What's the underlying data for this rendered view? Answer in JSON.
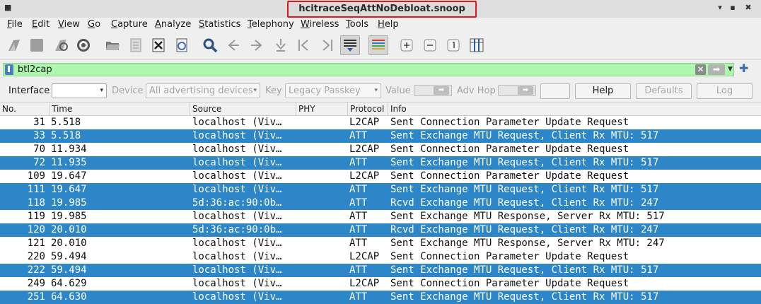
{
  "window": {
    "title": "hcitraceSeqAttNoDebloat.snoop",
    "app_icon": "■",
    "min_glyph": "▾",
    "max_glyph": "▪",
    "close_glyph": "✖"
  },
  "menu": [
    "File",
    "Edit",
    "View",
    "Go",
    "Capture",
    "Analyze",
    "Statistics",
    "Telephony",
    "Wireless",
    "Tools",
    "Help"
  ],
  "toolbar": {
    "icons": [
      "shark-fin-start-icon",
      "stop-capture-icon",
      "restart-capture-icon",
      "capture-options-icon",
      "open-file-icon",
      "save-file-icon",
      "close-file-icon",
      "reload-file-icon",
      "find-packet-icon",
      "go-back-icon",
      "go-forward-icon",
      "go-to-packet-icon",
      "first-packet-icon",
      "last-packet-icon",
      "auto-scroll-icon",
      "colorize-icon",
      "zoom-in-icon",
      "zoom-out-icon",
      "normal-size-icon",
      "resize-columns-icon"
    ]
  },
  "filter": {
    "value": "btl2cap",
    "clear_glyph": "✕",
    "apply_glyph": "➡",
    "dropdown_glyph": "▼",
    "add_glyph": "✚"
  },
  "interface_bar": {
    "interface_label": "Interface",
    "interface_value": "",
    "device_label": "Device",
    "device_value": "All advertising devices",
    "key_label": "Key",
    "key_value": "Legacy Passkey",
    "value_label": "Value",
    "adv_hop_label": "Adv Hop",
    "help_label": "Help",
    "defaults_label": "Defaults",
    "log_label": "Log",
    "arrow_glyph": "▾",
    "slider_glyph": "➡"
  },
  "packet_list": {
    "columns": [
      "No.",
      "Time",
      "Source",
      "PHY",
      "Protocol",
      "Info"
    ],
    "rows": [
      {
        "no": "31",
        "time": "5.518",
        "source": "localhost (Viv…",
        "phy": "",
        "protocol": "L2CAP",
        "info": "Sent Connection Parameter Update Request",
        "selected": false
      },
      {
        "no": "33",
        "time": "5.518",
        "source": "localhost (Viv…",
        "phy": "",
        "protocol": "ATT",
        "info": "Sent Exchange MTU Request, Client Rx MTU: 517",
        "selected": true
      },
      {
        "no": "70",
        "time": "11.934",
        "source": "localhost (Viv…",
        "phy": "",
        "protocol": "L2CAP",
        "info": "Sent Connection Parameter Update Request",
        "selected": false
      },
      {
        "no": "72",
        "time": "11.935",
        "source": "localhost (Viv…",
        "phy": "",
        "protocol": "ATT",
        "info": "Sent Exchange MTU Request, Client Rx MTU: 517",
        "selected": true
      },
      {
        "no": "109",
        "time": "19.647",
        "source": "localhost (Viv…",
        "phy": "",
        "protocol": "L2CAP",
        "info": "Sent Connection Parameter Update Request",
        "selected": false
      },
      {
        "no": "111",
        "time": "19.647",
        "source": "localhost (Viv…",
        "phy": "",
        "protocol": "ATT",
        "info": "Sent Exchange MTU Request, Client Rx MTU: 517",
        "selected": true
      },
      {
        "no": "118",
        "time": "19.985",
        "source": "5d:36:ac:90:0b…",
        "phy": "",
        "protocol": "ATT",
        "info": "Rcvd Exchange MTU Request, Client Rx MTU: 247",
        "selected": true
      },
      {
        "no": "119",
        "time": "19.985",
        "source": "localhost (Viv…",
        "phy": "",
        "protocol": "ATT",
        "info": "Sent Exchange MTU Response, Server Rx MTU: 517",
        "selected": false
      },
      {
        "no": "120",
        "time": "20.010",
        "source": "5d:36:ac:90:0b…",
        "phy": "",
        "protocol": "ATT",
        "info": "Rcvd Exchange MTU Request, Client Rx MTU: 247",
        "selected": true
      },
      {
        "no": "121",
        "time": "20.010",
        "source": "localhost (Viv…",
        "phy": "",
        "protocol": "ATT",
        "info": "Sent Exchange MTU Response, Server Rx MTU: 247",
        "selected": false
      },
      {
        "no": "220",
        "time": "59.494",
        "source": "localhost (Viv…",
        "phy": "",
        "protocol": "L2CAP",
        "info": "Sent Connection Parameter Update Request",
        "selected": false
      },
      {
        "no": "222",
        "time": "59.494",
        "source": "localhost (Viv…",
        "phy": "",
        "protocol": "ATT",
        "info": "Sent Exchange MTU Request, Client Rx MTU: 517",
        "selected": true
      },
      {
        "no": "249",
        "time": "64.629",
        "source": "localhost (Viv…",
        "phy": "",
        "protocol": "L2CAP",
        "info": "Sent Connection Parameter Update Request",
        "selected": false
      },
      {
        "no": "251",
        "time": "64.630",
        "source": "localhost (Viv…",
        "phy": "",
        "protocol": "ATT",
        "info": "Sent Exchange MTU Request, Client Rx MTU: 517",
        "selected": true
      }
    ]
  },
  "colors": {
    "selected_row": "#2c86c8",
    "filter_valid": "#aff7af",
    "title_highlight": "#e0191f"
  }
}
